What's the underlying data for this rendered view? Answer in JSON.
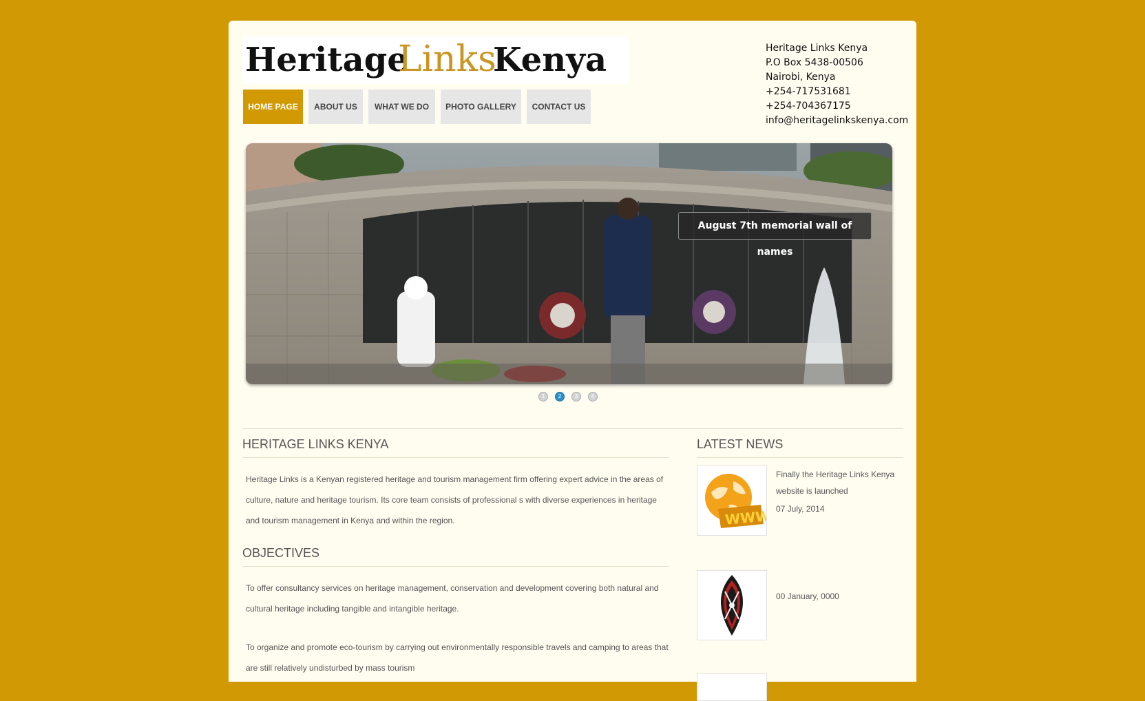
{
  "site": {
    "logo_text": "HeritageLinksKenya",
    "logo_parts": [
      "Heritage",
      "Links",
      "Kenya"
    ]
  },
  "contact": {
    "lines": [
      "Heritage Links Kenya",
      "P.O Box 5438-00506",
      "Nairobi, Kenya",
      "+254-717531681",
      "+254-704367175",
      "info@heritagelinkskenya.com"
    ]
  },
  "nav": {
    "items": [
      {
        "label": "HOME PAGE",
        "active": true
      },
      {
        "label": "ABOUT US",
        "active": false
      },
      {
        "label": "WHAT WE DO",
        "active": false
      },
      {
        "label": "PHOTO GALLERY",
        "active": false
      },
      {
        "label": "CONTACT US",
        "active": false
      }
    ]
  },
  "slider": {
    "caption": "August 7th memorial wall of names",
    "pages": [
      "1",
      "2",
      "3",
      "4"
    ],
    "current": 2
  },
  "main": {
    "heading": "HERITAGE LINKS KENYA",
    "intro": "Heritage Links is a Kenyan registered heritage and tourism management firm offering expert advice in the areas of culture, nature and heritage tourism. Its core team consists of professional s with diverse experiences in heritage and tourism management in Kenya and within the region.",
    "objectives_heading": "OBJECTIVES",
    "objectives": [
      "To offer consultancy services on heritage management, conservation and development covering both natural and cultural heritage including tangible and intangible heritage.",
      "To organize and promote eco-tourism by carrying out environmentally responsible travels and camping to areas that are still relatively undisturbed by mass tourism"
    ]
  },
  "news": {
    "heading": "LATEST NEWS",
    "items": [
      {
        "title": "Finally the Heritage Links Kenya website is launched",
        "date": "07 July, 2014",
        "image": "www-globe-icon"
      },
      {
        "title": "",
        "date": "00 January, 0000",
        "image": "maasai-shield-icon"
      }
    ]
  },
  "colors": {
    "background": "#d19a04",
    "page": "#fffdf0",
    "accent": "#d19a04",
    "nav_inactive": "#e6e6e6",
    "text": "#555555",
    "slider_dot_active": "#2b8fc9"
  }
}
